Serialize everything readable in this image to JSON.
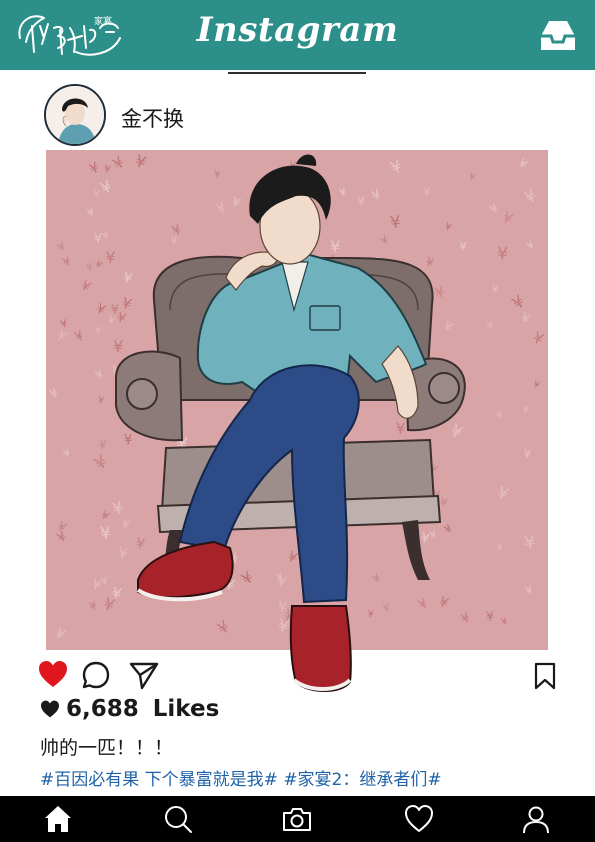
{
  "header": {
    "logo_text": "继承者们",
    "logo_sub": "家宴",
    "title": "Instagram"
  },
  "post": {
    "username": "金不换",
    "likes_count": "6,688",
    "likes_label": "Likes",
    "caption": "帅的一匹！！！",
    "hashtags": [
      "#百因必有果 下个暴富就是我#",
      "#家宴2：继承者们#"
    ],
    "liked": true,
    "background_symbol": "¥"
  },
  "colors": {
    "brand_teal": "#2c8f8a",
    "like_red": "#e0161e",
    "hashtag_blue": "#1f62a8",
    "nav_black": "#000000"
  },
  "icons": {
    "inbox": "inbox-icon",
    "like": "heart-filled-icon",
    "comment": "comment-bubble-icon",
    "share": "paper-plane-icon",
    "save": "bookmark-icon",
    "nav": [
      "home-icon",
      "search-icon",
      "camera-icon",
      "heart-outline-icon",
      "profile-icon"
    ]
  }
}
